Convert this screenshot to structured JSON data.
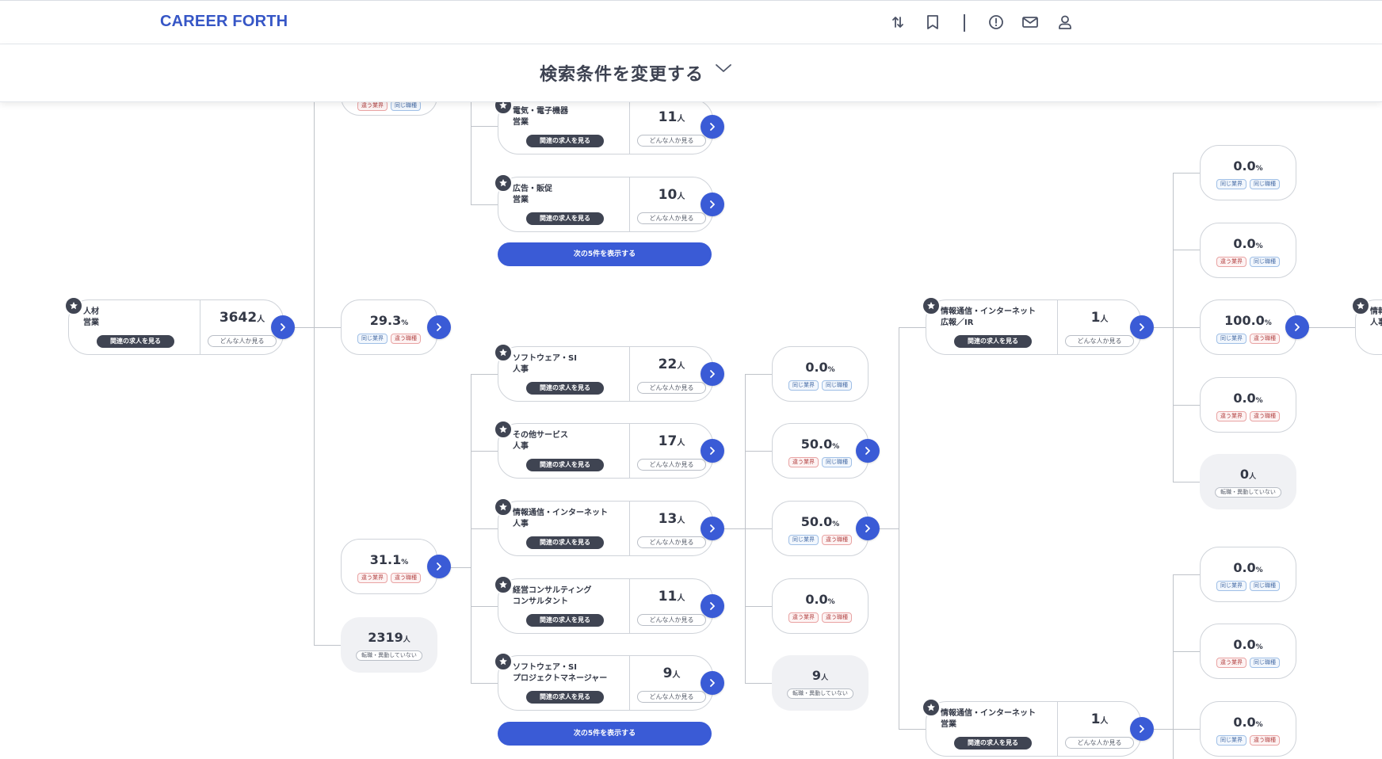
{
  "header": {
    "brand": "CAREER FORTH",
    "icons": [
      "swap-icon",
      "bookmark-icon",
      "alert-icon",
      "mail-icon",
      "user-icon"
    ]
  },
  "search": {
    "label": "検索条件を変更する"
  },
  "labels": {
    "view_jobs": "関連の求人を見る",
    "who": "どんな人か見る",
    "same_industry": "同じ業界",
    "diff_industry": "違う業界",
    "same_role": "同じ職種",
    "diff_role": "違う職種",
    "no_change": "転職・異動していない",
    "next5": "次の5件を表示する",
    "person_unit": "人",
    "percent_unit": "%"
  },
  "root": {
    "line1": "人材",
    "line2": "営業",
    "count": "3642"
  },
  "branches": [
    {
      "value": "29.3",
      "tags": [
        "same_industry",
        "diff_role"
      ]
    },
    {
      "value": "31.1",
      "tags": [
        "diff_industry",
        "diff_role"
      ]
    },
    {
      "value": "2319"
    }
  ],
  "level2_top": [
    {
      "line1": "電気・電子機器",
      "line2": "営業",
      "count": "11"
    },
    {
      "line1": "広告・販促",
      "line2": "営業",
      "count": "10"
    }
  ],
  "level2": [
    {
      "line1": "ソフトウェア・SI",
      "line2": "人事",
      "count": "22"
    },
    {
      "line1": "その他サービス",
      "line2": "人事",
      "count": "17"
    },
    {
      "line1": "情報通信・インターネット",
      "line2": "人事",
      "count": "13"
    },
    {
      "line1": "経営コンサルティング",
      "line2": "コンサルタント",
      "count": "11"
    },
    {
      "line1": "ソフトウェア・SI",
      "line2": "プロジェクトマネージャー",
      "count": "9"
    }
  ],
  "level3": [
    {
      "value": "0.0",
      "tags": [
        "same_industry",
        "same_role"
      ]
    },
    {
      "value": "50.0",
      "tags": [
        "diff_industry",
        "same_role"
      ]
    },
    {
      "value": "50.0",
      "tags": [
        "same_industry",
        "diff_role"
      ]
    },
    {
      "value": "0.0",
      "tags": [
        "diff_industry",
        "diff_role"
      ]
    },
    {
      "value": "9"
    }
  ],
  "level4": [
    {
      "line1": "情報通信・インターネット",
      "line2": "広報／IR",
      "count": "1"
    },
    {
      "line1": "情報通信・インターネット",
      "line2": "営業",
      "count": "1"
    }
  ],
  "level5_top": [
    {
      "value": "0.0",
      "tags": [
        "same_industry",
        "same_role"
      ]
    },
    {
      "value": "0.0",
      "tags": [
        "diff_industry",
        "same_role"
      ]
    },
    {
      "value": "100.0",
      "tags": [
        "same_industry",
        "diff_role"
      ]
    },
    {
      "value": "0.0",
      "tags": [
        "diff_industry",
        "diff_role"
      ]
    },
    {
      "value": "0"
    }
  ],
  "level5_bottom": [
    {
      "value": "0.0",
      "tags": [
        "same_industry",
        "same_role"
      ]
    },
    {
      "value": "0.0",
      "tags": [
        "diff_industry",
        "same_role"
      ]
    },
    {
      "value": "0.0",
      "tags": [
        "same_industry",
        "diff_role"
      ]
    }
  ],
  "edge_card": {
    "line1": "情報",
    "line2": "人事"
  }
}
